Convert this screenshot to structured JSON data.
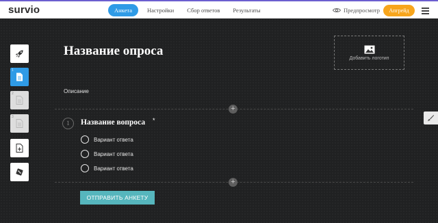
{
  "app": {
    "logo": "survio"
  },
  "nav": {
    "tabs": [
      {
        "label": "Анкета",
        "active": true
      },
      {
        "label": "Настройки",
        "active": false
      },
      {
        "label": "Сбор ответов",
        "active": false
      },
      {
        "label": "Результаты",
        "active": false
      }
    ],
    "preview_label": "Предпросмотр",
    "upgrade_label": "Апгрейд"
  },
  "sidebar": {
    "tools": [
      {
        "icon": "rocket-icon",
        "num": ""
      },
      {
        "icon": "document-icon",
        "num": "1",
        "active": true
      },
      {
        "icon": "document-icon",
        "num": "2"
      },
      {
        "icon": "document-icon",
        "num": "3"
      },
      {
        "icon": "add-page-icon",
        "num": ""
      },
      {
        "icon": "dice-icon",
        "num": ""
      }
    ]
  },
  "survey": {
    "title": "Название опроса",
    "logo_placeholder": "Добавить логотип",
    "description": "Описание",
    "question": {
      "number": "1",
      "title": "Название вопроса",
      "required_mark": "*",
      "options": [
        "Вариант ответа",
        "Вариант ответа",
        "Вариант ответа"
      ]
    },
    "submit_label": "ОТПРАВИТЬ АНКЕТУ"
  },
  "colors": {
    "accent": "#2f9be6",
    "upgrade": "#f7a51c",
    "submit": "#56b6bd",
    "background": "#1f2021"
  }
}
